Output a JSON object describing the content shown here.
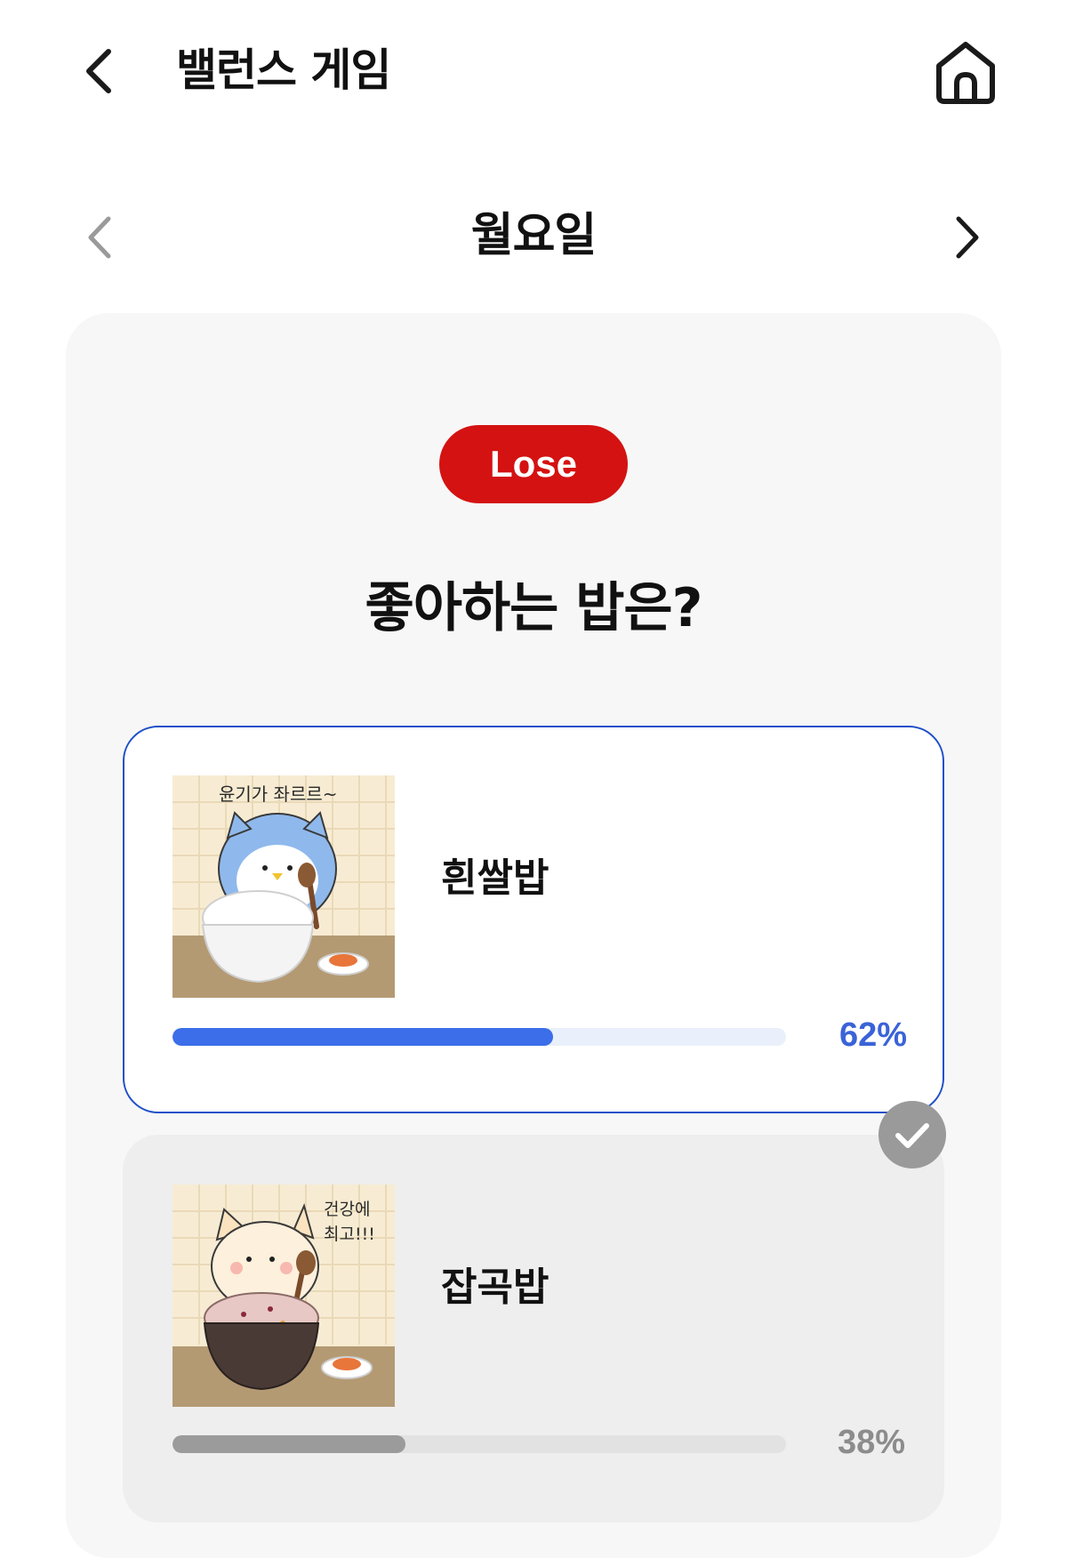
{
  "header": {
    "title": "밸런스 게임",
    "back_icon": "chevron-left-icon",
    "home_icon": "home-icon"
  },
  "day_nav": {
    "day": "월요일",
    "prev_icon": "chevron-left-icon",
    "next_icon": "chevron-right-icon"
  },
  "result": {
    "label": "Lose",
    "color": "#d41212"
  },
  "question": "좋아하는 밥은?",
  "options": [
    {
      "label": "흰쌀밥",
      "image_caption": "윤기가 좌르르~",
      "percent_text": "62%",
      "percent": 62,
      "highlighted": true,
      "bar_color": "#3b6ee8"
    },
    {
      "label": "잡곡밥",
      "image_caption_line1": "건강에",
      "image_caption_line2": "최고!!!",
      "percent_text": "38%",
      "percent": 38,
      "selected": true,
      "bar_color": "#9b9b9b"
    }
  ],
  "selected_icon": "check-icon",
  "colors": {
    "accent_blue": "#3b6ee8",
    "border_blue": "#1f4fc9",
    "lose_red": "#d41212"
  }
}
